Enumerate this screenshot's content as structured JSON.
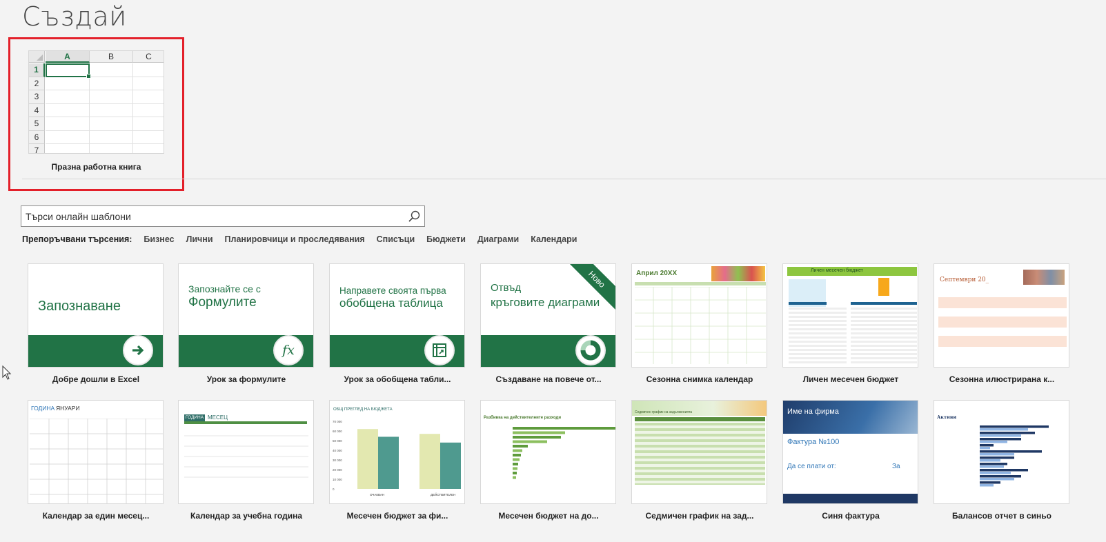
{
  "page_title": "Създай",
  "blank_workbook": {
    "label": "Празна работна книга",
    "columns": [
      "A",
      "B",
      "C"
    ],
    "rows": [
      "1",
      "2",
      "3",
      "4",
      "5",
      "6",
      "7"
    ]
  },
  "search": {
    "placeholder": "Търси онлайн шаблони"
  },
  "suggested": {
    "label": "Препоръчвани търсения:",
    "links": [
      "Бизнес",
      "Лични",
      "Планировчици и проследявания",
      "Списъци",
      "Бюджети",
      "Диаграми",
      "Календари"
    ]
  },
  "templates": [
    {
      "label": "Добре дошли в Excel",
      "title": "Запознаване"
    },
    {
      "label": "Урок за формулите",
      "title_line1": "Запознайте се с",
      "title_line2": "Формулите",
      "icon_text": "fx"
    },
    {
      "label": "Урок за обобщена табли...",
      "title_line1": "Направете своята първа",
      "title_line2": "обобщена таблица"
    },
    {
      "label": "Създаване на повече от...",
      "title_line1": "Отвъд",
      "title_line2": "кръговите диаграми",
      "badge": "Ново"
    },
    {
      "label": "Сезонна снимка календар",
      "heading": "Април 20XX"
    },
    {
      "label": "Личен месечен бюджет",
      "heading": "Личен месечен бюджет"
    },
    {
      "label": "Сезонна илюстрирана к...",
      "heading": "Септември 20_"
    },
    {
      "label": "Календар за един месец...",
      "heading1": "ГОДИНА",
      "heading2": "ЯНУАРИ"
    },
    {
      "label": "Календар за учебна година",
      "heading1": "ГОДИНА",
      "heading2": "МЕСЕЦ"
    },
    {
      "label": "Месечен бюджет за фи...",
      "heading": "ОБЩ ПРЕГЛЕД НА БЮДЖЕТА",
      "y_ticks": [
        "70 000",
        "60 000",
        "50 000",
        "40 000",
        "30 000",
        "20 000",
        "10 000",
        "0"
      ],
      "categories": [
        "ОЧАКВАН",
        "ДЕЙСТВИТЕЛЕН"
      ]
    },
    {
      "label": "Месечен бюджет на до...",
      "heading": "Разбивка на действителните разходи"
    },
    {
      "label": "Седмичен график на зад...",
      "heading": "Седмичен график на задълженията"
    },
    {
      "label": "Синя фактура",
      "company": "Име на фирма",
      "invoice": "Фактура №100",
      "bill_to": "Да се плати от:",
      "for": "За"
    },
    {
      "label": "Балансов отчет в синьо",
      "heading": "Активи"
    }
  ],
  "colors": {
    "excel_green": "#217346",
    "highlight_red": "#e3202a",
    "navy": "#1f3864"
  }
}
